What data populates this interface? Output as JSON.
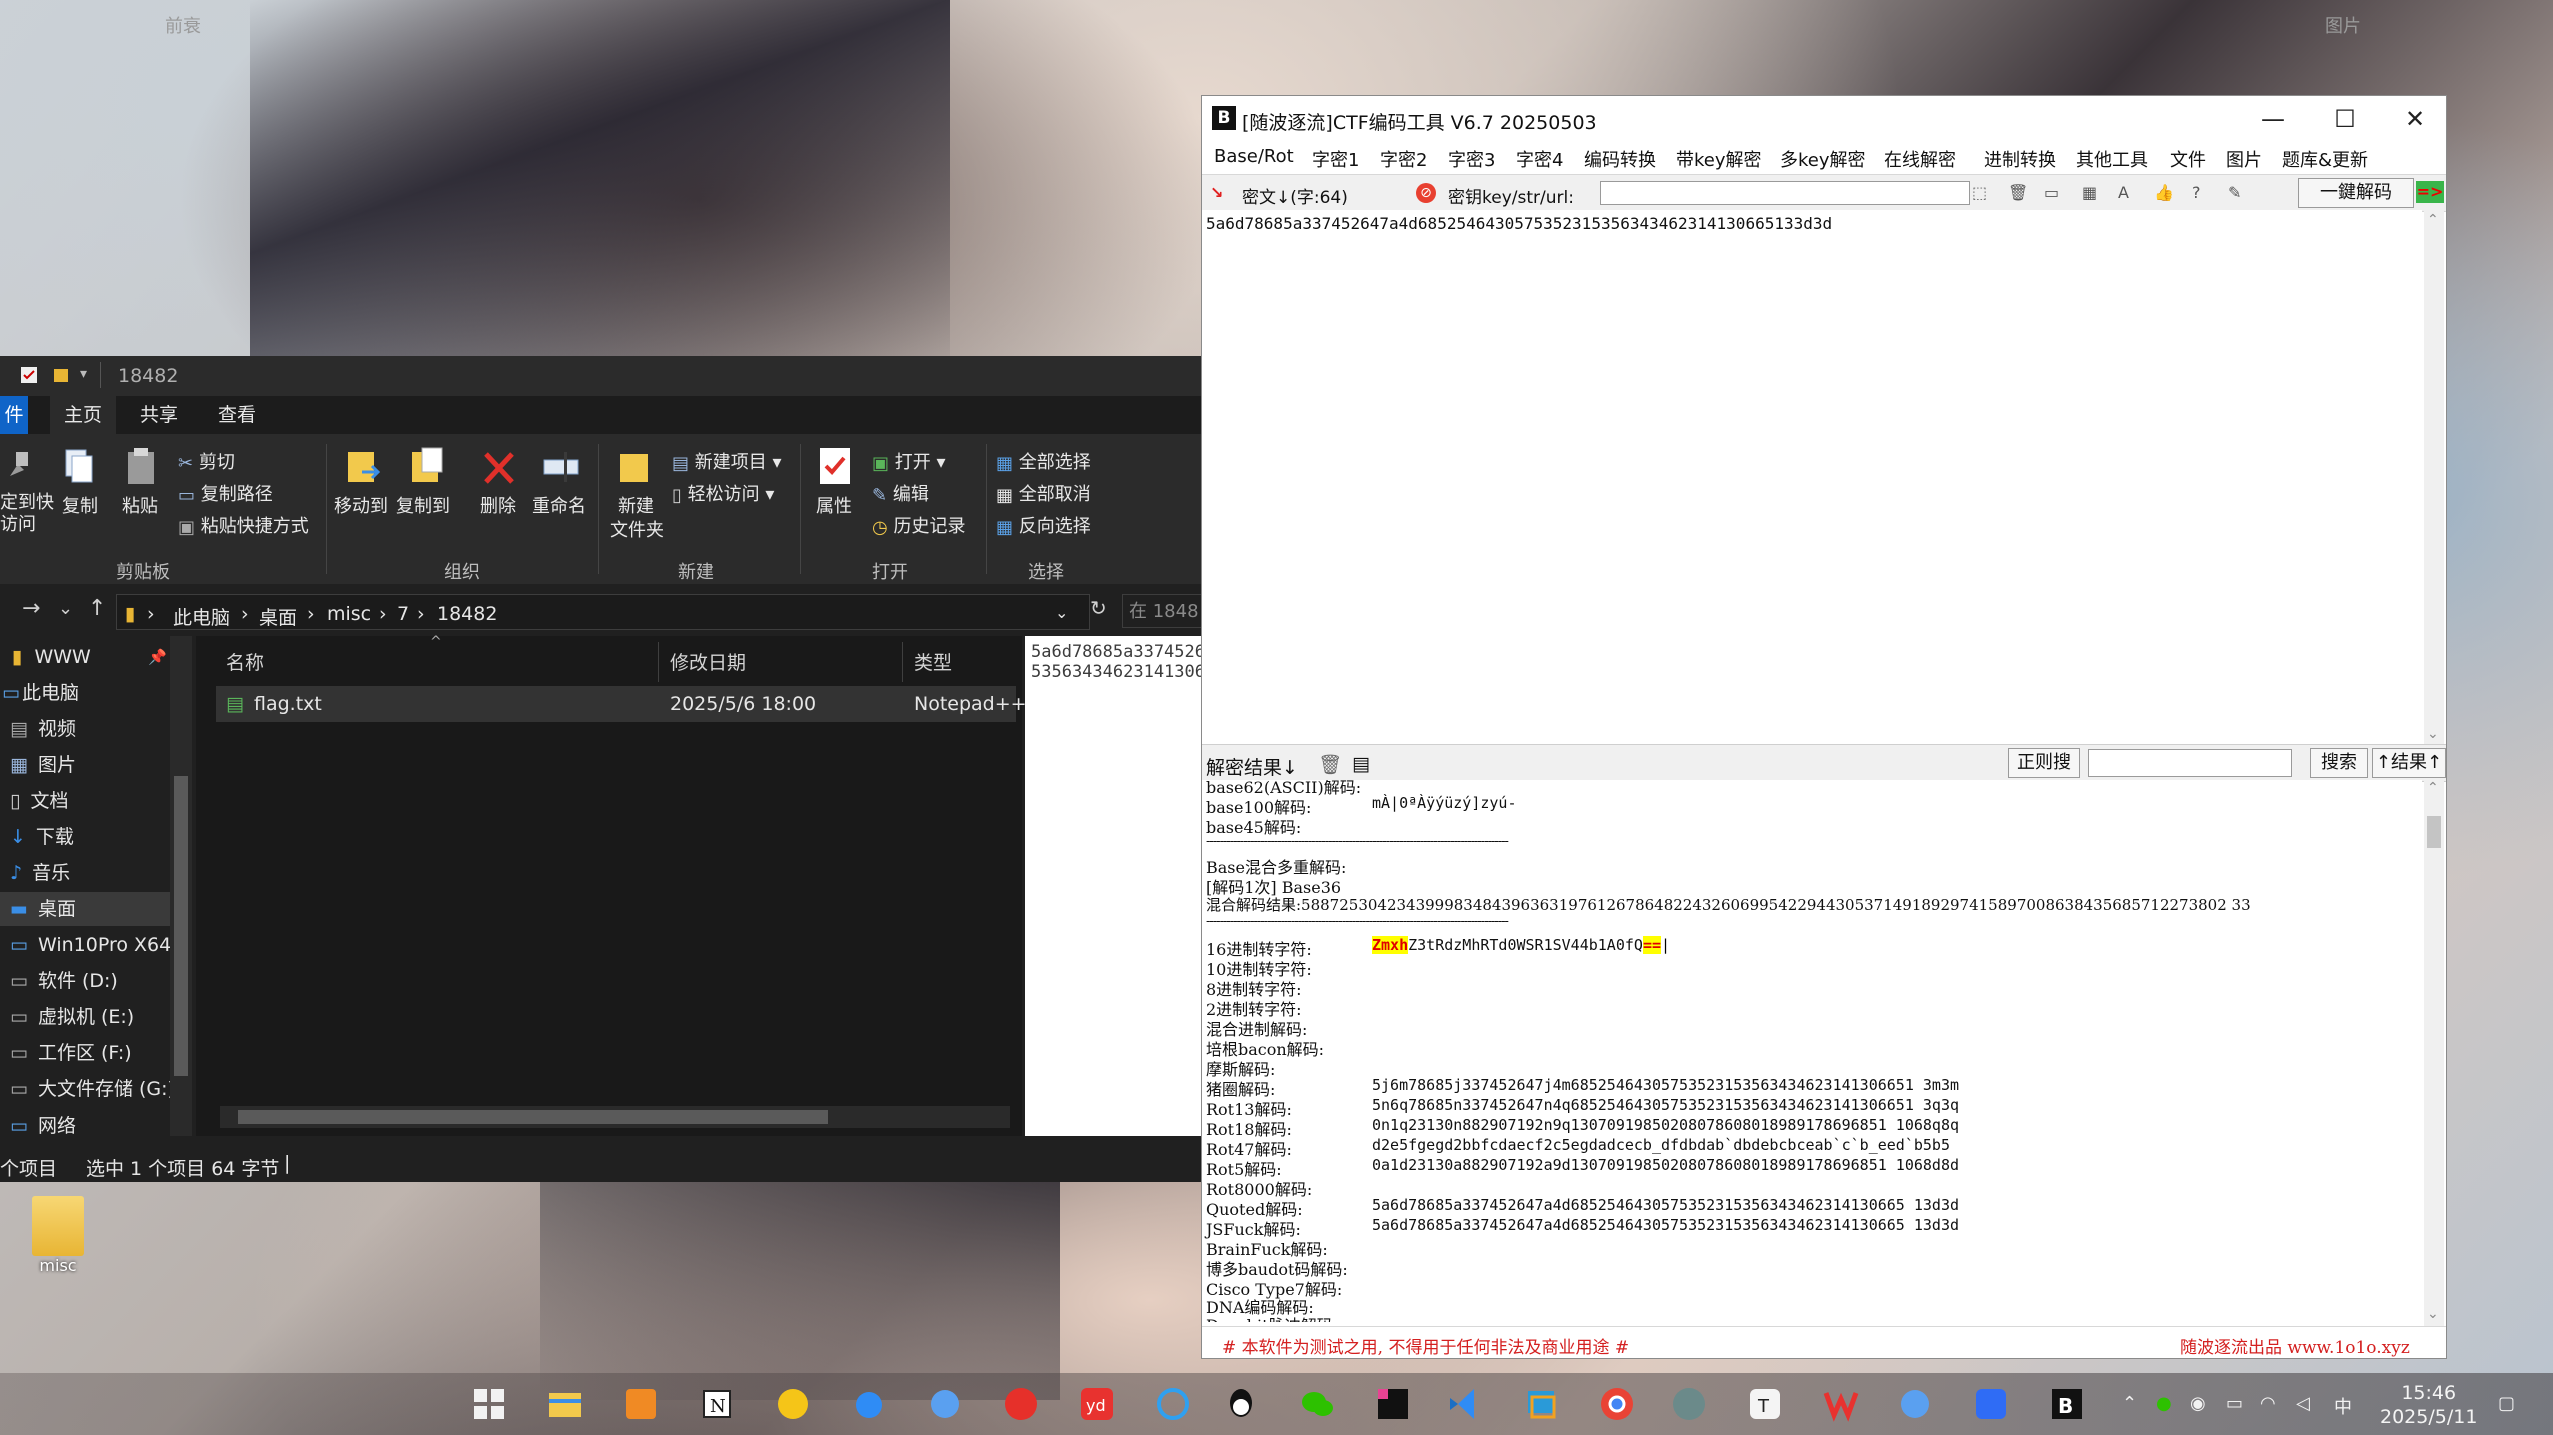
{
  "wallpaper": {
    "label_left": "前衰",
    "label_right": "图片"
  },
  "explorer": {
    "window_title": "18482",
    "tabs": [
      "件",
      "主页",
      "共享",
      "查看"
    ],
    "ribbon": {
      "pin": "定到快\n访问",
      "copy": "复制",
      "paste": "粘贴",
      "cut": "剪切",
      "copy_path": "复制路径",
      "paste_shortcut": "粘贴快捷方式",
      "group_clipboard": "剪贴板",
      "move_to": "移动到",
      "copy_to": "复制到",
      "delete": "删除",
      "rename": "重命名",
      "group_organize": "组织",
      "new_item": "新建项目",
      "easy_access": "轻松访问",
      "new_folder_1": "新建",
      "new_folder_2": "文件夹",
      "group_new": "新建",
      "properties": "属性",
      "open": "打开",
      "edit": "编辑",
      "history": "历史记录",
      "group_open": "打开",
      "select_all": "全部选择",
      "select_none": "全部取消",
      "invert_selection": "反向选择",
      "group_select": "选择"
    },
    "breadcrumb": [
      "此电脑",
      "桌面",
      "misc",
      "7",
      "18482"
    ],
    "search_placeholder": "在 1848",
    "nav_items": [
      {
        "label": "WWW",
        "icon": "folder-icon"
      },
      {
        "label": "此电脑",
        "icon": "computer-icon"
      },
      {
        "label": "视频",
        "icon": "video-icon"
      },
      {
        "label": "图片",
        "icon": "picture-icon"
      },
      {
        "label": "文档",
        "icon": "document-icon"
      },
      {
        "label": "下载",
        "icon": "download-icon"
      },
      {
        "label": "音乐",
        "icon": "music-icon"
      },
      {
        "label": "桌面",
        "icon": "desktop-icon"
      },
      {
        "label": "Win10Pro X64 (",
        "icon": "drive-icon"
      },
      {
        "label": "软件 (D:)",
        "icon": "drive-icon"
      },
      {
        "label": "虚拟机 (E:)",
        "icon": "drive-icon"
      },
      {
        "label": "工作区 (F:)",
        "icon": "drive-icon"
      },
      {
        "label": "大文件存储 (G:)",
        "icon": "drive-icon"
      },
      {
        "label": "网络",
        "icon": "network-icon"
      }
    ],
    "columns": {
      "name": "名称",
      "date": "修改日期",
      "type": "类型"
    },
    "file": {
      "name": "flag.txt",
      "date": "2025/5/6 18:00",
      "type": "Notepad++"
    },
    "preview_lines": [
      "5a6d78685a3374526",
      "53563434623141306"
    ],
    "status": {
      "items": "个项目",
      "selected": "选中 1 个项目  64 字节"
    }
  },
  "ctf": {
    "title": "[随波逐流]CTF编码工具 V6.7  20250503",
    "logo": "B",
    "menus": [
      "Base/Rot",
      "字密1",
      "字密2",
      "字密3",
      "字密4",
      "编码转换",
      "带key解密",
      "多key解密",
      "在线解密",
      "进制转换",
      "其他工具",
      "文件",
      "图片",
      "题库&更新"
    ],
    "toolbar": {
      "cipher_label": "密文↓(字:64)",
      "key_label": "密钥key/str/url:",
      "one_key": "一鍵解码",
      "arrow": "=>"
    },
    "input_text": "5a6d78685a337452647a4d6852546430575352315356343462314130665133d3d",
    "result_bar": {
      "label": "解密结果↓",
      "regex": "正则搜",
      "search": "搜索",
      "up_result": "↑结果↑"
    },
    "results": [
      {
        "label": "base62(ASCII)解码:",
        "value": ""
      },
      {
        "label": "base100解码:",
        "value": "mÀ|0ªÀÿýüzý]zyú-"
      },
      {
        "label": "base45解码:",
        "value": ""
      },
      {
        "label": "-----------------------------------------------------------------------------------------",
        "value": ""
      },
      {
        "label": "Base混合多重解码:",
        "value": ""
      },
      {
        "label": "[解码1次] Base36",
        "value": ""
      },
      {
        "label": "混合解码结果:5887253042343999834843963631976126786482243260699542294430537149189297415897008638435685712273802 33",
        "value": ""
      },
      {
        "label": "-----------------------------------------------------------------------------------------",
        "value": ""
      },
      {
        "label": "16进制转字符:",
        "value": "",
        "hl_start": "Zmxh",
        "mid": "Z3tRdzMhRTd0WSR1SV44b1A0fQ",
        "hl_end": "=="
      },
      {
        "label": "10进制转字符:",
        "value": ""
      },
      {
        "label": "8进制转字符:",
        "value": ""
      },
      {
        "label": "2进制转字符:",
        "value": ""
      },
      {
        "label": "混合进制解码:",
        "value": ""
      },
      {
        "label": "培根bacon解码:",
        "value": ""
      },
      {
        "label": "摩斯解码:",
        "value": ""
      },
      {
        "label": "猪圈解码:",
        "value": "5j6m78685j337452647j4m68525464305753523153563434623141306651 3m3m"
      },
      {
        "label": "Rot13解码:",
        "value": "5n6q78685n337452647n4q68525464305753523153563434623141306651 3q3q"
      },
      {
        "label": "Rot18解码:",
        "value": "0n1q23130n882907192n9q13070919850208078608018989178696851 1068q8q"
      },
      {
        "label": "Rot47解码:",
        "value": "d2e5fgegd2bbfcdaecf2c5egdadcecb_dfdbdab`dbdebcbceab`c`b_eed`b5b5"
      },
      {
        "label": "Rot5解码:",
        "value": "0a1d23130a882907192a9d13070919850208078608018989178696851 1068d8d"
      },
      {
        "label": "Rot8000解码:",
        "value": ""
      },
      {
        "label": "Quoted解码:",
        "value": "5a6d78685a337452647a4d6852546430575352315356343462314130665 13d3d"
      },
      {
        "label": "JSFuck解码:",
        "value": "5a6d78685a337452647a4d6852546430575352315356343462314130665 13d3d"
      },
      {
        "label": "BrainFuck解码:",
        "value": ""
      },
      {
        "label": "博多baudot码解码:",
        "value": ""
      },
      {
        "label": "Cisco Type7解码:",
        "value": ""
      },
      {
        "label": "DNA编码解码:",
        "value": ""
      },
      {
        "label": "Decabit脉冲解码:",
        "value": ""
      }
    ],
    "footer_left": "# 本软件为测试之用, 不得用于任何非法及商业用途 #",
    "footer_right": "随波逐流出品 www.1o1o.xyz"
  },
  "desktop_icon": {
    "label": "misc"
  },
  "taskbar": {
    "apps": [
      "start-icon",
      "explorer-icon",
      "app-orange-icon",
      "notion-icon",
      "app-yellow-icon",
      "baidu-cloud-icon",
      "app-blue-icon",
      "netease-music-icon",
      "youdao-icon",
      "app-cyan-icon",
      "qq-icon",
      "wechat-icon",
      "jetbrains-icon",
      "vscode-icon",
      "vmware-icon",
      "chrome-icon",
      "avatar-icon",
      "typora-icon",
      "wps-icon",
      "app-blue2-icon",
      "app-blue3-icon",
      "ctf-tool-icon"
    ],
    "ime": "中",
    "time": "15:46",
    "date": "2025/5/11"
  },
  "colors": {
    "accent": "#0f64c8",
    "highlight": "#ffff00",
    "highlight_text": "#e00000",
    "footer_red": "#d42020"
  }
}
